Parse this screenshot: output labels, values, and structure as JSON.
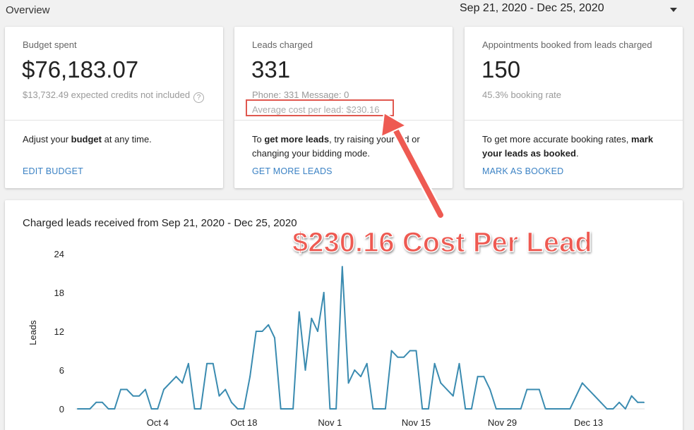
{
  "header": {
    "title": "Overview",
    "date_range": "Sep 21, 2020 - Dec 25, 2020"
  },
  "cards": {
    "budget": {
      "label": "Budget spent",
      "value": "$76,183.07",
      "sub": "$13,732.49 expected credits not included",
      "desc_pre": "Adjust your ",
      "desc_bold": "budget",
      "desc_post": " at any time.",
      "link": "EDIT BUDGET"
    },
    "leads": {
      "label": "Leads charged",
      "value": "331",
      "sub": "Phone: 331  Message: 0",
      "sub2": "Average cost per lead: $230.16",
      "desc_pre": "To ",
      "desc_bold": "get more leads",
      "desc_post": ", try raising your bid or changing your bidding mode.",
      "link": "GET MORE LEADS"
    },
    "appointments": {
      "label": "Appointments booked from leads charged",
      "value": "150",
      "sub": "45.3% booking rate",
      "desc_pre": "To get more accurate booking rates, ",
      "desc_bold": "mark your leads as booked",
      "desc_post": ".",
      "link": "MARK AS BOOKED"
    }
  },
  "annotation": {
    "callout": "$230.16 Cost Per Lead",
    "color": "#ee5a52"
  },
  "chart_data": {
    "type": "line",
    "title": "Charged leads received from Sep 21, 2020 - Dec 25, 2020",
    "ylabel": "Leads",
    "ylim": [
      0,
      24
    ],
    "yticks": [
      0,
      6,
      12,
      18,
      24
    ],
    "x_tick_labels": [
      "Oct 4",
      "Oct 18",
      "Nov 1",
      "Nov 15",
      "Nov 29",
      "Dec 13"
    ],
    "x_tick_days": [
      13,
      27,
      41,
      55,
      69,
      83
    ],
    "line_color": "#3a8bb0",
    "grid": false,
    "series": [
      {
        "x": [
          0,
          1,
          2,
          3,
          4,
          5,
          6,
          7,
          8,
          9,
          10,
          11,
          12,
          13,
          14,
          15,
          16,
          17,
          18,
          19,
          20,
          21,
          22,
          23,
          24,
          25,
          26,
          27,
          28,
          29,
          30,
          31,
          32,
          33,
          34,
          35,
          36,
          37,
          38,
          39,
          40,
          41,
          42,
          43,
          44,
          45,
          46,
          47,
          48,
          49,
          50,
          51,
          52,
          53,
          54,
          55,
          56,
          57,
          58,
          59,
          60,
          61,
          62,
          63,
          64,
          65,
          66,
          67,
          68,
          69,
          70,
          71,
          72,
          73,
          74,
          75,
          76,
          77,
          78,
          79,
          80,
          81,
          82,
          83,
          84,
          85,
          86,
          87,
          88,
          89,
          90,
          91,
          92
        ],
        "y": [
          0,
          0,
          0,
          1,
          1,
          0,
          0,
          3,
          3,
          2,
          2,
          3,
          0,
          0,
          3,
          4,
          5,
          4,
          7,
          0,
          0,
          7,
          7,
          2,
          3,
          1,
          0,
          0,
          5,
          12,
          12,
          13,
          11,
          0,
          0,
          0,
          15,
          6,
          14,
          12,
          18,
          0,
          0,
          22,
          4,
          6,
          5,
          7,
          0,
          0,
          0,
          9,
          8,
          8,
          9,
          9,
          0,
          0,
          7,
          4,
          3,
          2,
          7,
          0,
          0,
          5,
          5,
          3,
          0,
          0,
          0,
          0,
          0,
          3,
          3,
          3,
          0,
          0,
          0,
          0,
          0,
          2,
          4,
          3,
          2,
          1,
          0,
          0,
          1,
          0,
          2,
          1,
          1
        ]
      }
    ]
  }
}
